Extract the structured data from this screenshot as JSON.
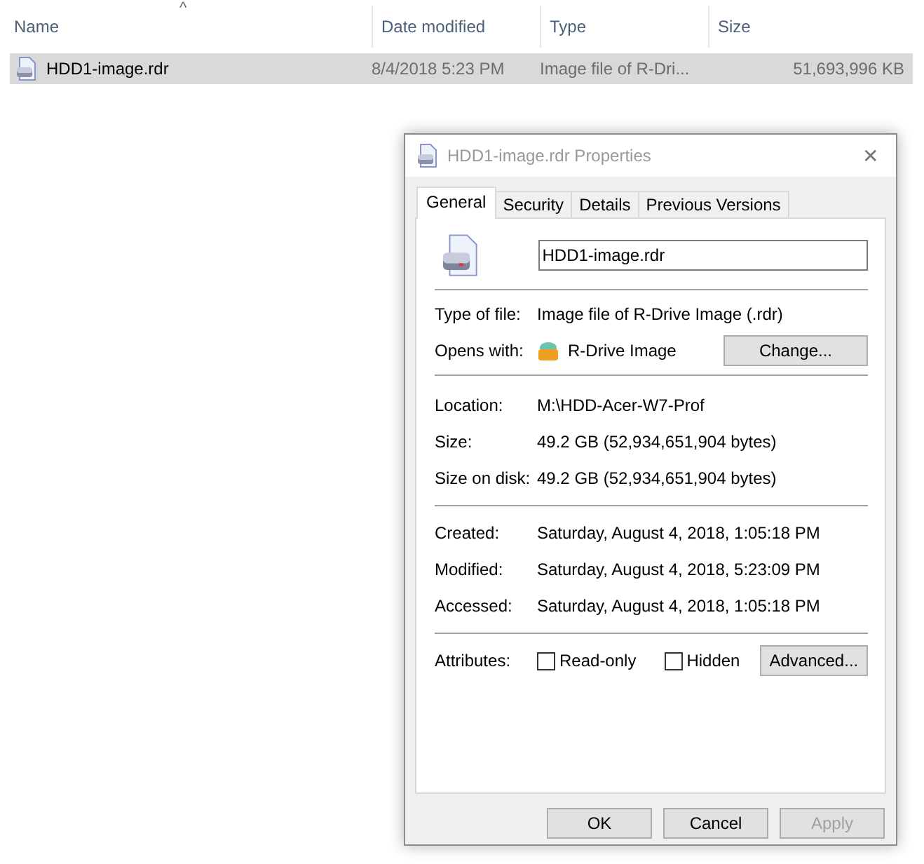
{
  "explorer": {
    "sort_indicator": "^",
    "columns": [
      {
        "label": "Name"
      },
      {
        "label": "Date modified"
      },
      {
        "label": "Type"
      },
      {
        "label": "Size"
      }
    ],
    "rows": [
      {
        "name": "HDD1-image.rdr",
        "date_modified": "8/4/2018 5:23 PM",
        "type": "Image file of R-Dri...",
        "size": "51,693,996 KB",
        "selected": true
      }
    ]
  },
  "dialog": {
    "title": "HDD1-image.rdr Properties",
    "close": "✕",
    "tabs": [
      {
        "label": "General",
        "selected": true
      },
      {
        "label": "Security",
        "selected": false
      },
      {
        "label": "Details",
        "selected": false
      },
      {
        "label": "Previous Versions",
        "selected": false
      }
    ],
    "file_name": "HDD1-image.rdr",
    "type_of_file": {
      "label": "Type of file:",
      "value": "Image file of R-Drive Image (.rdr)"
    },
    "opens_with": {
      "label": "Opens with:",
      "app": "R-Drive Image",
      "button": "Change..."
    },
    "info": [
      {
        "label": "Location:",
        "value": "M:\\HDD-Acer-W7-Prof"
      },
      {
        "label": "Size:",
        "value": "49.2 GB (52,934,651,904 bytes)"
      },
      {
        "label": "Size on disk:",
        "value": "49.2 GB (52,934,651,904 bytes)"
      }
    ],
    "dates": [
      {
        "label": "Created:",
        "value": "Saturday, August 4, 2018, 1:05:18 PM"
      },
      {
        "label": "Modified:",
        "value": "Saturday, August 4, 2018, 5:23:09 PM"
      },
      {
        "label": "Accessed:",
        "value": "Saturday, August 4, 2018, 1:05:18 PM"
      }
    ],
    "attributes": {
      "label": "Attributes:",
      "checkboxes": [
        {
          "label": "Read-only",
          "checked": false
        },
        {
          "label": "Hidden",
          "checked": false
        }
      ],
      "button": "Advanced..."
    },
    "buttons": [
      {
        "label": "OK",
        "disabled": false
      },
      {
        "label": "Cancel",
        "disabled": false
      },
      {
        "label": "Apply",
        "disabled": true
      }
    ]
  }
}
